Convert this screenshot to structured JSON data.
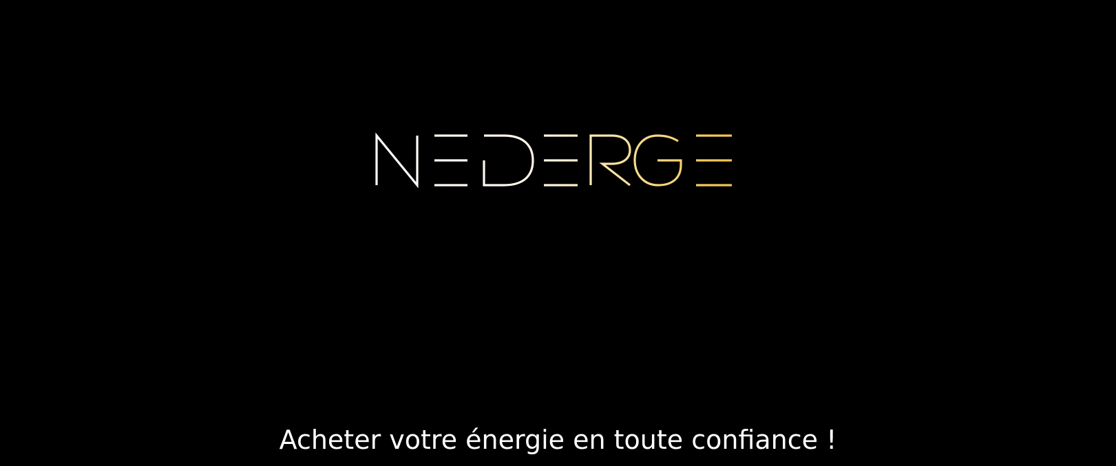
{
  "brand": {
    "logo_text": "NEDERGE",
    "gradient_colors": [
      "#ffffff",
      "#f0c24c"
    ]
  },
  "tagline": "Acheter votre énergie en toute confiance !",
  "colors": {
    "background": "#000000",
    "tagline_text": "#ffffff"
  }
}
